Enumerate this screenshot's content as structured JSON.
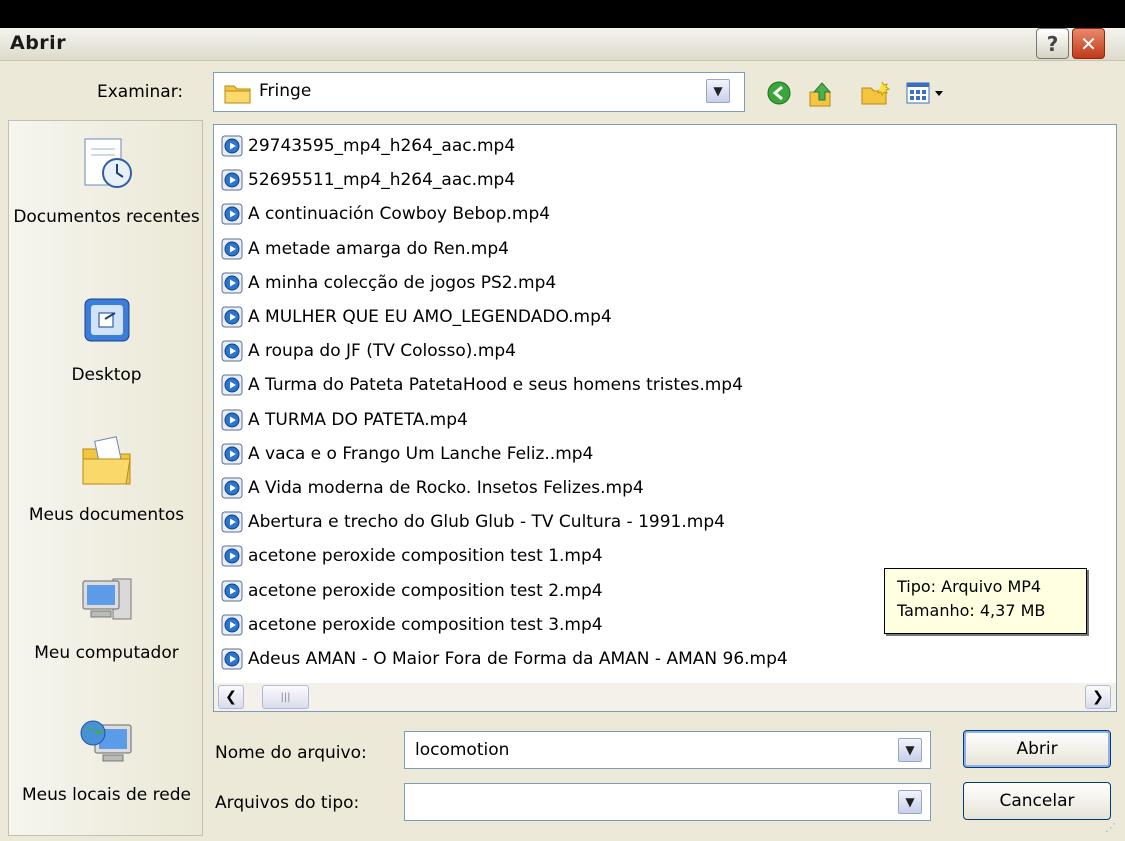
{
  "window": {
    "title": "Abrir",
    "help_glyph": "?",
    "close_glyph": "✕"
  },
  "look_in": {
    "label": "Examinar:",
    "value": "Fringe"
  },
  "toolbar": {
    "icons": [
      "back-icon",
      "up-folder-icon",
      "new-folder-icon",
      "view-menu-icon"
    ]
  },
  "places": [
    {
      "label": "Documentos recentes",
      "icon": "recent-documents-icon"
    },
    {
      "label": "Desktop",
      "icon": "desktop-icon"
    },
    {
      "label": "Meus documentos",
      "icon": "my-documents-icon"
    },
    {
      "label": "Meu computador",
      "icon": "my-computer-icon"
    },
    {
      "label": "Meus locais de rede",
      "icon": "network-places-icon"
    }
  ],
  "files": [
    "29743595_mp4_h264_aac.mp4",
    "52695511_mp4_h264_aac.mp4",
    "A continuación Cowboy Bebop.mp4",
    "A metade amarga do Ren.mp4",
    "A minha colecção de jogos PS2.mp4",
    "A MULHER QUE EU AMO_LEGENDADO.mp4",
    "A roupa do JF (TV Colosso).mp4",
    "A Turma do Pateta PatetaHood e seus homens tristes.mp4",
    "A TURMA DO PATETA.mp4",
    "A vaca e o Frango Um Lanche Feliz..mp4",
    "A Vida moderna de Rocko. Insetos Felizes.mp4",
    "Abertura e trecho do Glub Glub - TV Cultura - 1991.mp4",
    "acetone peroxide composition test 1.mp4",
    "acetone peroxide composition test 2.mp4",
    "acetone peroxide composition test 3.mp4",
    "Adeus AMAN - O Maior Fora de Forma da AMAN - AMAN 96.mp4"
  ],
  "tooltip": {
    "line1": "Tipo: Arquivo MP4",
    "line2": "Tamanho: 4,37 MB"
  },
  "filename": {
    "label": "Nome do arquivo:",
    "value": "locomotion"
  },
  "filetype": {
    "label": "Arquivos do tipo:",
    "value": ""
  },
  "buttons": {
    "open": "Abrir",
    "cancel": "Cancelar"
  },
  "colors": {
    "window_bg": "#ECE9D8",
    "field_border": "#7f9db9",
    "tooltip_bg": "#ffffe1"
  }
}
